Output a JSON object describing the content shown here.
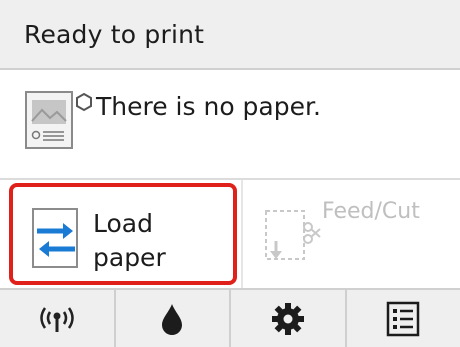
{
  "status": {
    "text": "Ready to print"
  },
  "message": {
    "text": "There is no paper.",
    "icon": "paper-status-icon"
  },
  "actions": {
    "load": {
      "label": "Load paper",
      "icon": "load-paper-icon",
      "highlight_color": "#e0201a"
    },
    "feed": {
      "label": "Feed/Cut",
      "icon": "feed-cut-icon",
      "enabled": false
    }
  },
  "tabs": [
    {
      "id": "network",
      "icon": "wireless-icon"
    },
    {
      "id": "ink",
      "icon": "ink-drop-icon"
    },
    {
      "id": "settings",
      "icon": "gear-icon"
    },
    {
      "id": "jobs",
      "icon": "list-icon"
    }
  ]
}
